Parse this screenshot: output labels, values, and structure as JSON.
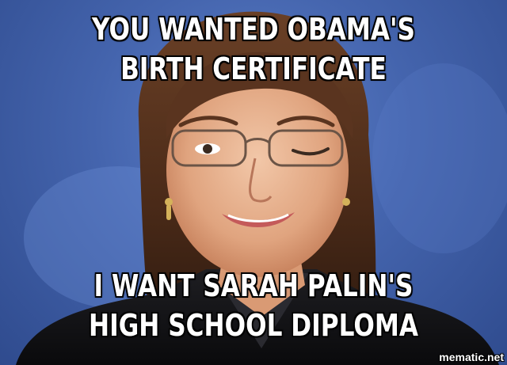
{
  "meme": {
    "top_text": "YOU WANTED OBAMA'S BIRTH CERTIFICATE",
    "bottom_text": "I WANT SARAH PALIN'S HIGH SCHOOL DIPLOMA",
    "watermark": "mematic.net"
  },
  "colors": {
    "background_blue": "#4464ad",
    "caption_text": "#ffffff",
    "caption_outline": "#000000"
  }
}
